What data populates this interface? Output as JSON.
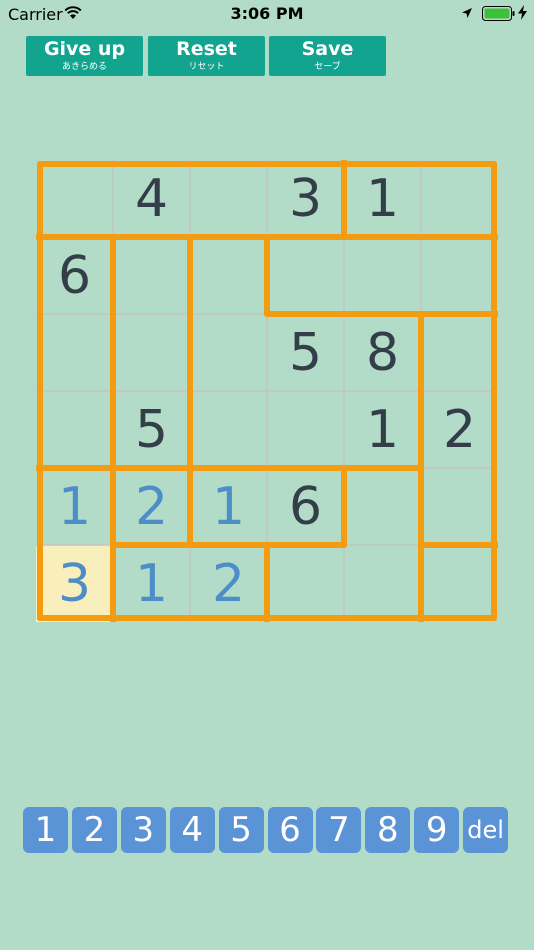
{
  "status": {
    "carrier": "Carrier",
    "time": "3:06 PM"
  },
  "toolbar": {
    "giveup": {
      "label": "Give up",
      "sub": "あきらめる"
    },
    "reset": {
      "label": "Reset",
      "sub": "リセット"
    },
    "save": {
      "label": "Save",
      "sub": "セーブ"
    }
  },
  "colors": {
    "background": "#b2dcc7",
    "button": "#13a48f",
    "region_border": "#f39c12",
    "given_digit": "#333e48",
    "entered_digit": "#4e8ec8",
    "selected_cell": "#f8efbc",
    "keypad": "#5a94d6"
  },
  "board": {
    "size": 6,
    "selected": [
      5,
      0
    ],
    "cells": [
      [
        {
          "v": "",
          "t": ""
        },
        {
          "v": "4",
          "t": "given"
        },
        {
          "v": "",
          "t": ""
        },
        {
          "v": "3",
          "t": "given"
        },
        {
          "v": "1",
          "t": "given"
        },
        {
          "v": "",
          "t": ""
        }
      ],
      [
        {
          "v": "6",
          "t": "given"
        },
        {
          "v": "",
          "t": ""
        },
        {
          "v": "",
          "t": ""
        },
        {
          "v": "",
          "t": ""
        },
        {
          "v": "",
          "t": ""
        },
        {
          "v": "",
          "t": ""
        }
      ],
      [
        {
          "v": "",
          "t": ""
        },
        {
          "v": "",
          "t": ""
        },
        {
          "v": "",
          "t": ""
        },
        {
          "v": "5",
          "t": "given"
        },
        {
          "v": "8",
          "t": "given"
        },
        {
          "v": "",
          "t": ""
        }
      ],
      [
        {
          "v": "",
          "t": ""
        },
        {
          "v": "5",
          "t": "given"
        },
        {
          "v": "",
          "t": ""
        },
        {
          "v": "",
          "t": ""
        },
        {
          "v": "1",
          "t": "given"
        },
        {
          "v": "2",
          "t": "given"
        }
      ],
      [
        {
          "v": "1",
          "t": "entered"
        },
        {
          "v": "2",
          "t": "entered"
        },
        {
          "v": "1",
          "t": "entered"
        },
        {
          "v": "6",
          "t": "given"
        },
        {
          "v": "",
          "t": ""
        },
        {
          "v": "",
          "t": ""
        }
      ],
      [
        {
          "v": "3",
          "t": "entered"
        },
        {
          "v": "1",
          "t": "entered"
        },
        {
          "v": "2",
          "t": "entered"
        },
        {
          "v": "",
          "t": ""
        },
        {
          "v": "",
          "t": ""
        },
        {
          "v": "",
          "t": ""
        }
      ]
    ],
    "regions": [
      [
        0,
        0,
        0,
        0,
        1,
        1
      ],
      [
        2,
        3,
        4,
        5,
        5,
        5
      ],
      [
        2,
        3,
        4,
        4,
        4,
        6
      ],
      [
        2,
        3,
        4,
        4,
        4,
        6
      ],
      [
        7,
        8,
        9,
        9,
        10,
        6
      ],
      [
        7,
        11,
        11,
        10,
        10,
        12
      ]
    ]
  },
  "keypad": [
    "1",
    "2",
    "3",
    "4",
    "5",
    "6",
    "7",
    "8",
    "9",
    "del"
  ]
}
